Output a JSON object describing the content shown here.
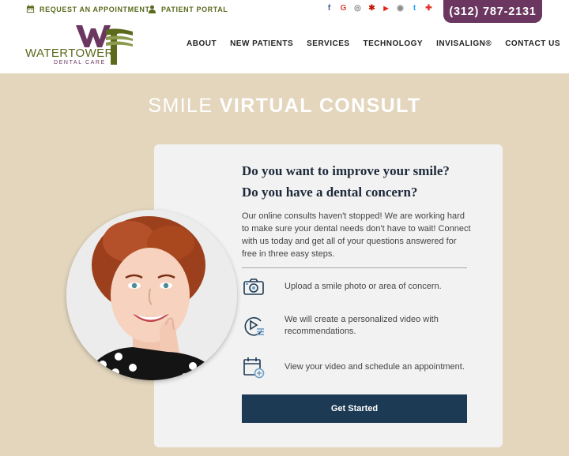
{
  "topbar": {
    "request_label": "Request an Appointment",
    "portal_label": "Patient Portal",
    "phone": "(312) 787-2131",
    "social": [
      {
        "name": "facebook-icon",
        "glyph": "f",
        "color": "#3b5998"
      },
      {
        "name": "google-icon",
        "glyph": "G",
        "color": "#db4437"
      },
      {
        "name": "instagram-icon",
        "glyph": "◎",
        "color": "#8a8a8a"
      },
      {
        "name": "yelp-icon",
        "glyph": "✱",
        "color": "#c41200"
      },
      {
        "name": "youtube-icon",
        "glyph": "▶",
        "color": "#e62117"
      },
      {
        "name": "rss-icon",
        "glyph": "◉",
        "color": "#8a8a8a"
      },
      {
        "name": "twitter-icon",
        "glyph": "t",
        "color": "#1da1f2"
      },
      {
        "name": "health-icon",
        "glyph": "✚",
        "color": "#e0302a"
      }
    ]
  },
  "logo": {
    "name": "WATERTOWER",
    "sub": "DENTAL CARE"
  },
  "nav": [
    "About",
    "New Patients",
    "Services",
    "Technology",
    "Invisalign®",
    "Contact Us"
  ],
  "hero": {
    "title_light": "Smile",
    "title_bold": "Virtual Consult"
  },
  "card": {
    "question1": "Do you want to improve your smile?",
    "question2": "Do you have a dental concern?",
    "intro": "Our online consults haven't stopped! We are working hard to make sure your dental needs don't have to wait! Connect with us today and get all of your questions answered for free in three easy steps.",
    "steps": [
      {
        "icon": "camera-icon",
        "text": "Upload a smile photo or area of concern."
      },
      {
        "icon": "video-play-icon",
        "text": "We will create a personalized video with recommendations."
      },
      {
        "icon": "calendar-add-icon",
        "text": "View your video and schedule an appointment."
      }
    ],
    "cta": "Get Started"
  },
  "colors": {
    "brand_purple": "#6b3760",
    "brand_olive": "#5b6a1d",
    "hero_bg": "#e3d6bd",
    "cta_bg": "#1d3a55"
  }
}
